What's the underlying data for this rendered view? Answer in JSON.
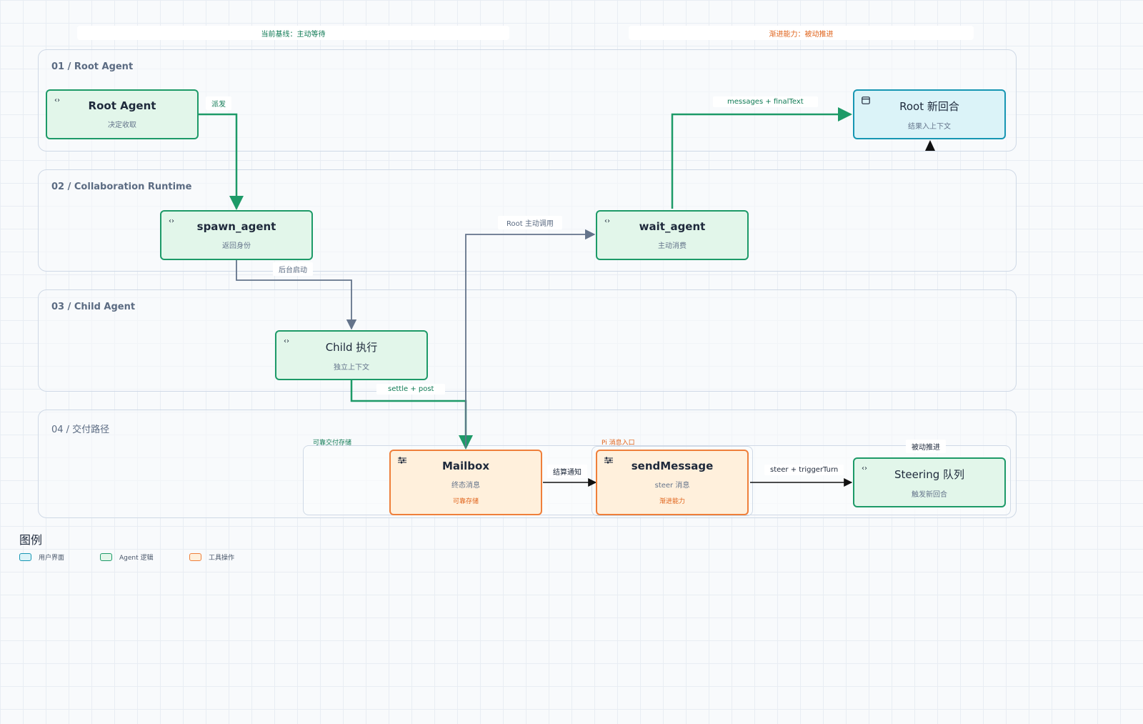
{
  "headers": {
    "left": "当前基线：主动等待",
    "right": "渐进能力：被动推进"
  },
  "lanes": [
    {
      "title": "01 / Root Agent"
    },
    {
      "title": "02 / Collaboration Runtime"
    },
    {
      "title": "03 / Child Agent"
    },
    {
      "title": "04 / 交付路径"
    }
  ],
  "nodes": {
    "root_agent": {
      "title": "Root Agent",
      "subtitle": "决定收取",
      "icon": "code-icon"
    },
    "root_new_round": {
      "title": "Root 新回合",
      "subtitle": "结果入上下文",
      "icon": "window-icon"
    },
    "spawn_agent": {
      "title": "spawn_agent",
      "subtitle": "返回身份",
      "icon": "code-icon"
    },
    "wait_agent": {
      "title": "wait_agent",
      "subtitle": "主动消费",
      "icon": "code-icon"
    },
    "child_exec": {
      "title": "Child 执行",
      "subtitle": "独立上下文",
      "icon": "code-icon"
    },
    "mailbox": {
      "title": "Mailbox",
      "subtitle": "终态消息",
      "tag": "可靠存储",
      "icon": "sliders-icon"
    },
    "send_message": {
      "title": "sendMessage",
      "subtitle": "steer 消息",
      "tag": "渐进能力",
      "icon": "sliders-icon"
    },
    "steering": {
      "title": "Steering 队列",
      "subtitle": "触发新回合",
      "icon": "code-icon"
    }
  },
  "edges": {
    "dispatch": "派发",
    "messages_final": "messages + finalText",
    "root_call": "Root 主动调用",
    "bg_start": "后台启动",
    "settle_post": "settle + post",
    "settle_notify": "结算通知",
    "steer_trigger": "steer + triggerTurn",
    "passive_push": "被动推进"
  },
  "group_labels": {
    "reliable_delivery": "可靠交付存储",
    "pi_entry": "Pi 消息入口"
  },
  "legend": {
    "title": "图例",
    "items": [
      {
        "label": "用户界面",
        "color": "#1796b3",
        "fill": "#dbf3f8"
      },
      {
        "label": "Agent 逻辑",
        "color": "#1d9a68",
        "fill": "#e2f6ea"
      },
      {
        "label": "工具操作",
        "color": "#ef7f3a",
        "fill": "#fff0dc"
      }
    ]
  },
  "colors": {
    "agent_border": "#1d9a68",
    "ui_border": "#1796b3",
    "tool_border": "#ef7f3a",
    "edge_green": "#1d9a68",
    "edge_slate": "#64748b",
    "edge_dark": "#111111"
  }
}
